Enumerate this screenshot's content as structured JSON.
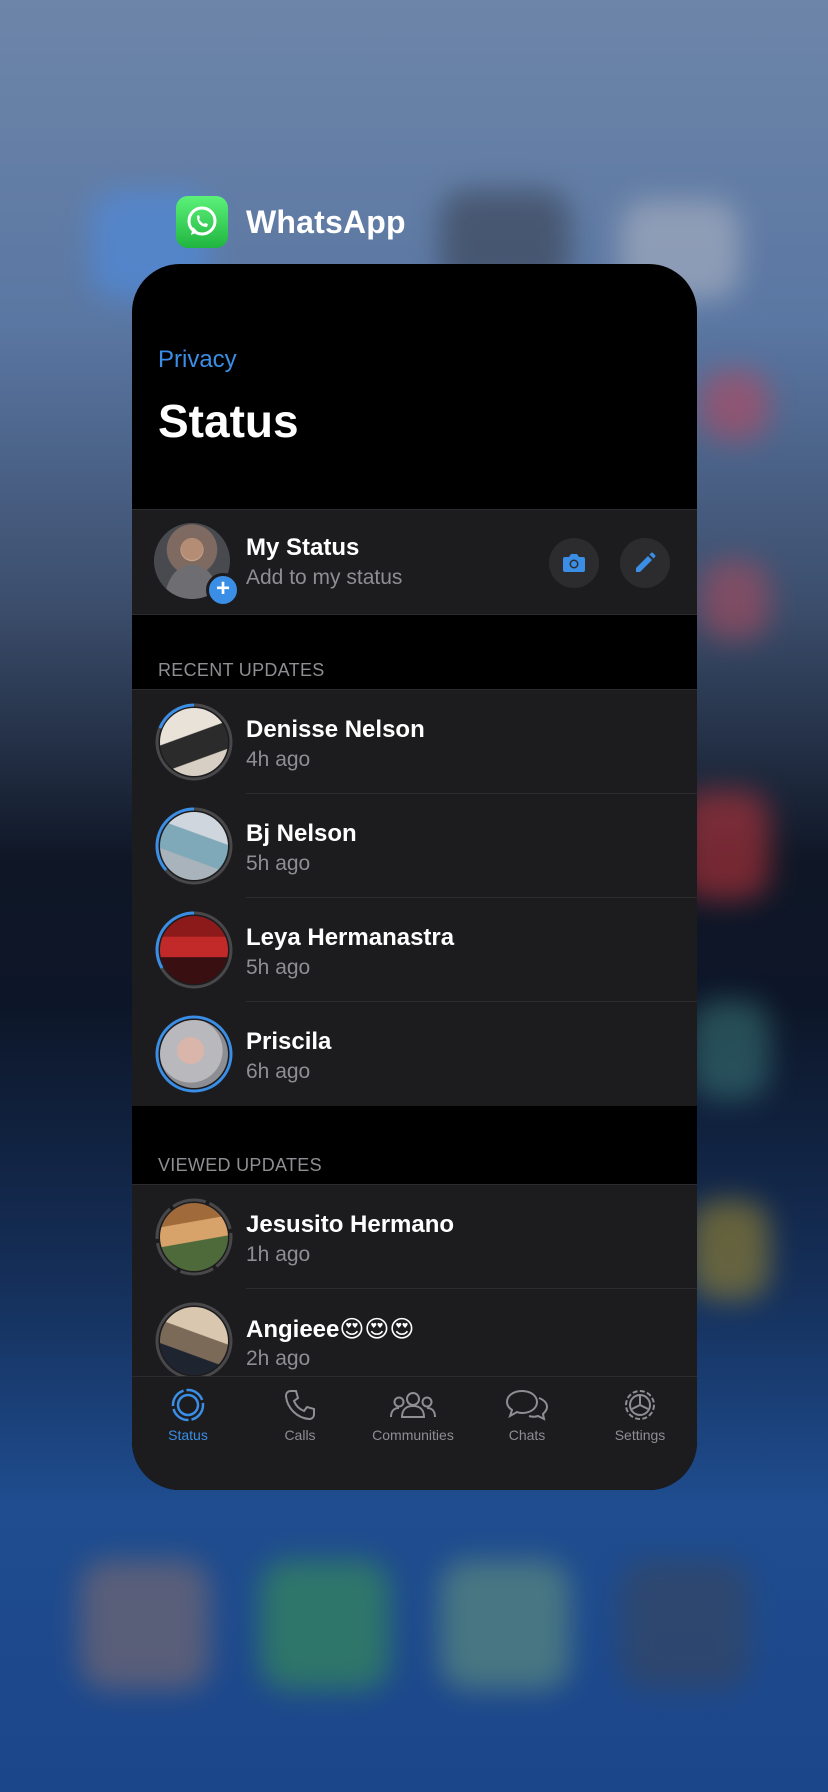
{
  "app": {
    "name": "WhatsApp"
  },
  "nav": {
    "back_label": "Privacy",
    "title": "Status"
  },
  "my_status": {
    "name": "My Status",
    "subtitle": "Add to my status"
  },
  "recent": {
    "header": "RECENT UPDATES",
    "items": [
      {
        "name": "Denisse Nelson",
        "time": "4h ago"
      },
      {
        "name": "Bj Nelson",
        "time": "5h ago"
      },
      {
        "name": "Leya Hermanastra",
        "time": "5h ago"
      },
      {
        "name": "Priscila",
        "time": "6h ago"
      }
    ]
  },
  "viewed": {
    "header": "VIEWED UPDATES",
    "items": [
      {
        "name": "Jesusito Hermano",
        "time": "1h ago"
      },
      {
        "name": "Angieee😍😍😍",
        "time": "2h ago"
      }
    ]
  },
  "tabs": [
    {
      "label": "Status",
      "icon": "status-icon",
      "active": true
    },
    {
      "label": "Calls",
      "icon": "phone-icon"
    },
    {
      "label": "Communities",
      "icon": "communities-icon"
    },
    {
      "label": "Chats",
      "icon": "chats-icon"
    },
    {
      "label": "Settings",
      "icon": "gear-icon"
    }
  ],
  "colors": {
    "accent": "#3a8ee6",
    "surface": "#1c1c1e",
    "background": "#000000"
  }
}
